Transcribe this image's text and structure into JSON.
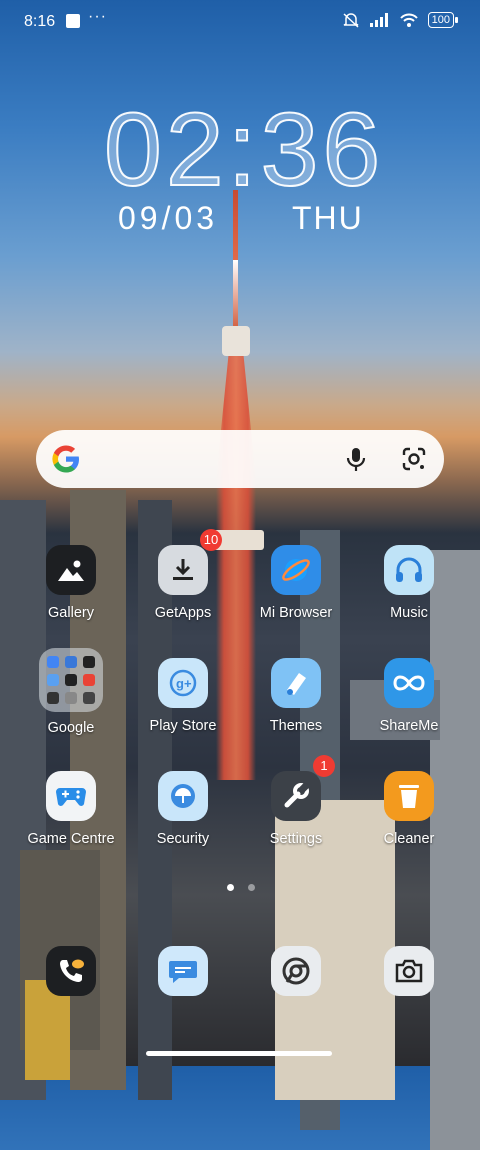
{
  "status": {
    "time": "8:16",
    "dots": "···",
    "battery": "100"
  },
  "lockscreen": {
    "clock": "02:36",
    "date": "09/03",
    "weekday": "THU"
  },
  "apps": {
    "gallery": "Gallery",
    "getapps": "GetApps",
    "getapps_badge": "10",
    "mi_browser": "Mi Browser",
    "music": "Music",
    "google_folder": "Google",
    "play_store": "Play Store",
    "themes": "Themes",
    "shareme": "ShareMe",
    "game_centre": "Game Centre",
    "security": "Security",
    "settings": "Settings",
    "settings_badge": "1",
    "cleaner": "Cleaner"
  },
  "colors": {
    "badge": "#f03b32",
    "google_blue": "#4285F4",
    "google_red": "#EA4335",
    "google_yellow": "#FBBC05",
    "google_green": "#34A853"
  }
}
